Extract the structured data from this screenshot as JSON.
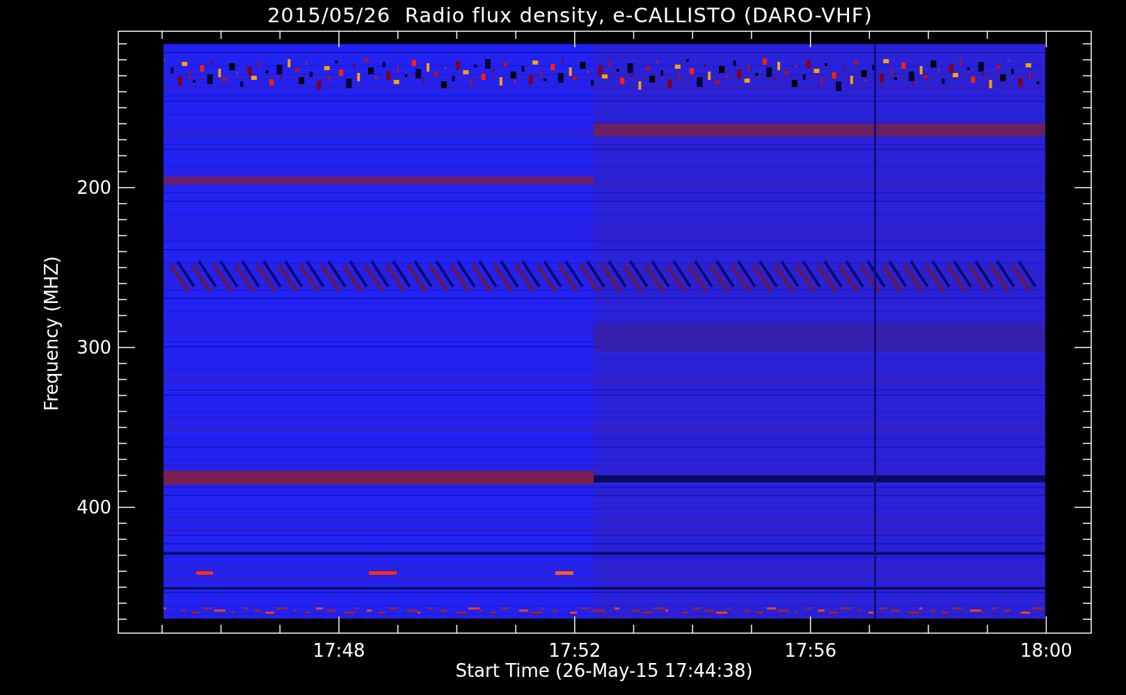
{
  "title": "2015/05/26  Radio flux density, e-CALLISTO (DARO-VHF)",
  "plot": {
    "ylabel": "Frequency (MHZ)",
    "xlabel": "Start Time (26-May-15 17:44:38)",
    "yticks": [
      {
        "label": "200"
      },
      {
        "label": "300"
      },
      {
        "label": "400"
      }
    ],
    "xticks": [
      {
        "label": "17:48"
      },
      {
        "label": "17:52"
      },
      {
        "label": "17:56"
      },
      {
        "label": "18:00"
      }
    ]
  }
}
